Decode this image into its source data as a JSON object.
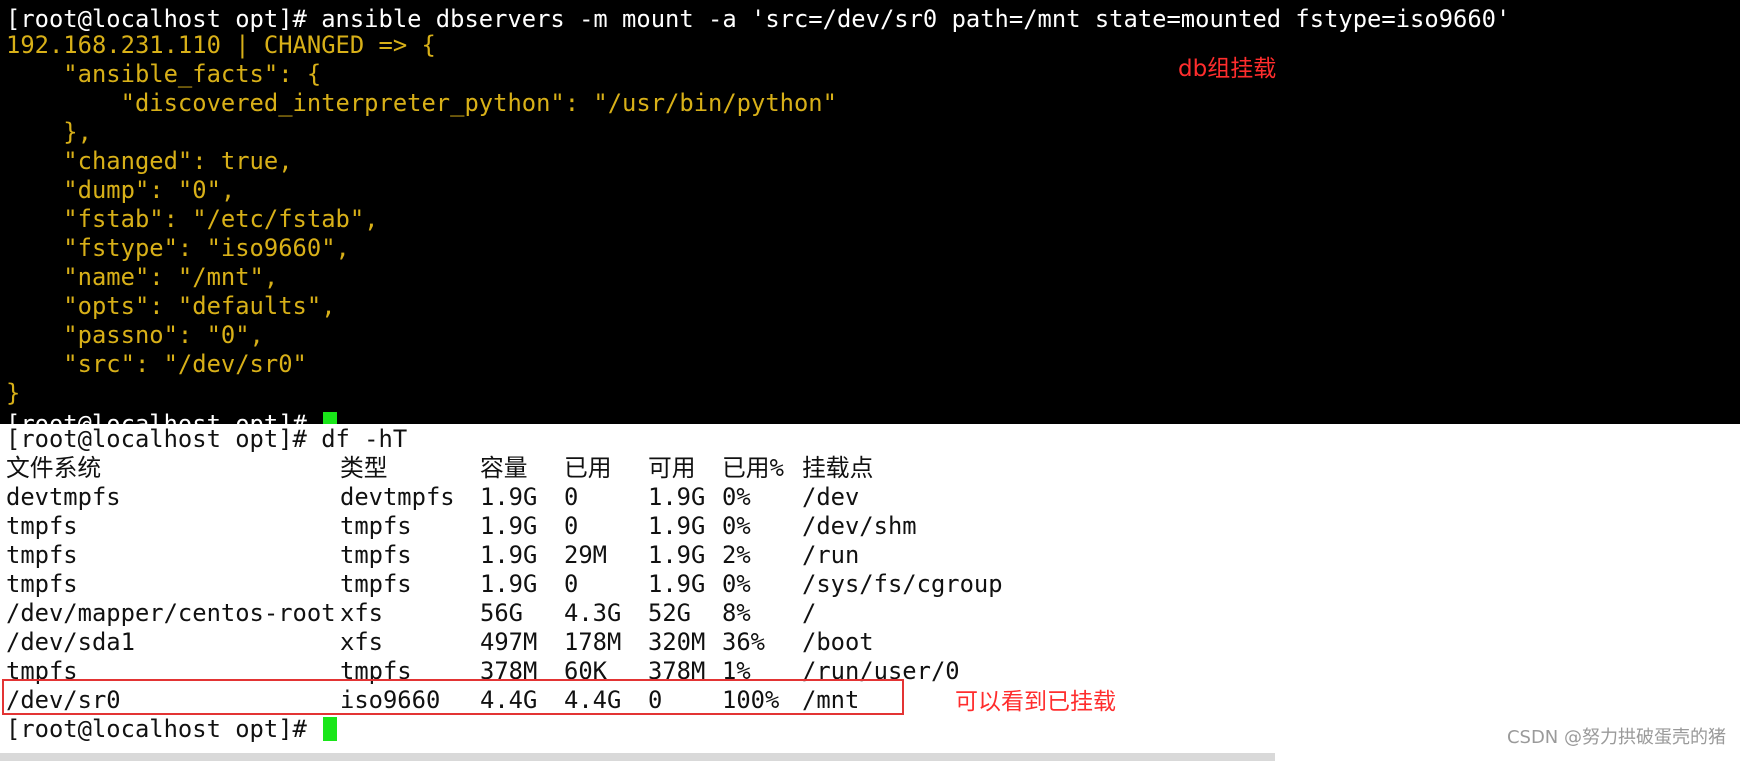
{
  "terminal_top": {
    "command_line": "[root@localhost opt]# ansible dbservers -m mount -a 'src=/dev/sr0 path=/mnt state=mounted fstype=iso9660'",
    "output_lines": [
      "192.168.231.110 | CHANGED => {",
      "    \"ansible_facts\": {",
      "        \"discovered_interpreter_python\": \"/usr/bin/python\"",
      "    },",
      "    \"changed\": true,",
      "    \"dump\": \"0\",",
      "    \"fstab\": \"/etc/fstab\",",
      "    \"fstype\": \"iso9660\",",
      "    \"name\": \"/mnt\",",
      "    \"opts\": \"defaults\",",
      "    \"passno\": \"0\",",
      "    \"src\": \"/dev/sr0\"",
      "}"
    ],
    "cut_prompt": "[root@localhost opt]# "
  },
  "annotations": {
    "db_mount_note": "db组挂载",
    "can_see_mounted_note": "可以看到已挂载"
  },
  "terminal_bottom": {
    "command_line": "[root@localhost opt]# df -hT",
    "headers": {
      "filesystem": "文件系统",
      "type": "类型",
      "size": "容量",
      "used": "已用",
      "avail": "可用",
      "use_pct": "已用%",
      "mounted_on": "挂载点"
    },
    "rows": [
      {
        "filesystem": "devtmpfs",
        "type": "devtmpfs",
        "size": "1.9G",
        "used": "0",
        "avail": "1.9G",
        "use_pct": "0%",
        "mounted_on": "/dev"
      },
      {
        "filesystem": "tmpfs",
        "type": "tmpfs",
        "size": "1.9G",
        "used": "0",
        "avail": "1.9G",
        "use_pct": "0%",
        "mounted_on": "/dev/shm"
      },
      {
        "filesystem": "tmpfs",
        "type": "tmpfs",
        "size": "1.9G",
        "used": "29M",
        "avail": "1.9G",
        "use_pct": "2%",
        "mounted_on": "/run"
      },
      {
        "filesystem": "tmpfs",
        "type": "tmpfs",
        "size": "1.9G",
        "used": "0",
        "avail": "1.9G",
        "use_pct": "0%",
        "mounted_on": "/sys/fs/cgroup"
      },
      {
        "filesystem": "/dev/mapper/centos-root",
        "type": "xfs",
        "size": "56G",
        "used": "4.3G",
        "avail": "52G",
        "use_pct": "8%",
        "mounted_on": "/"
      },
      {
        "filesystem": "/dev/sda1",
        "type": "xfs",
        "size": "497M",
        "used": "178M",
        "avail": "320M",
        "use_pct": "36%",
        "mounted_on": "/boot"
      },
      {
        "filesystem": "tmpfs",
        "type": "tmpfs",
        "size": "378M",
        "used": "60K",
        "avail": "378M",
        "use_pct": "1%",
        "mounted_on": "/run/user/0"
      },
      {
        "filesystem": "/dev/sr0",
        "type": "iso9660",
        "size": "4.4G",
        "used": "4.4G",
        "avail": "0",
        "use_pct": "100%",
        "mounted_on": "/mnt"
      }
    ],
    "final_prompt": "[root@localhost opt]# "
  },
  "watermark": "CSDN @努力拱破蛋壳的猪",
  "colors": {
    "terminal_bg": "#000000",
    "yellow_text": "#d8b018",
    "cursor_green": "#19e619",
    "annotation_red": "#ff2d2d"
  }
}
